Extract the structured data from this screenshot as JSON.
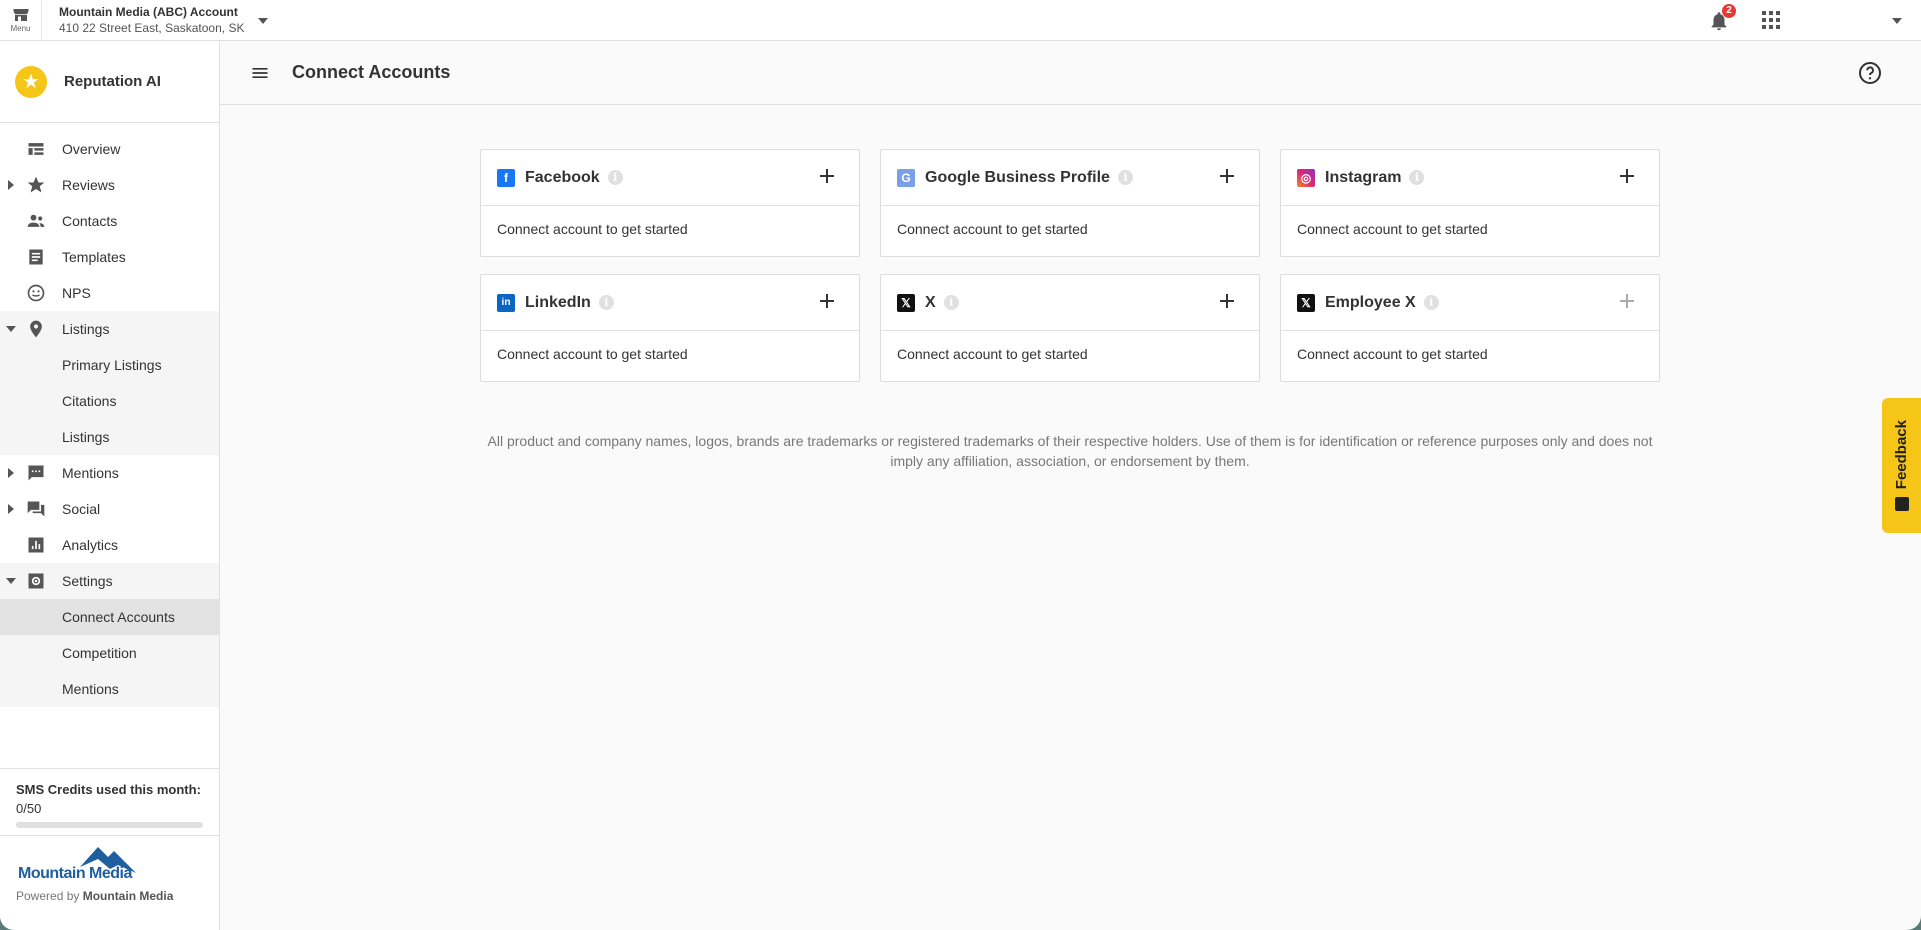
{
  "topbar": {
    "menu_label": "Menu",
    "account_name": "Mountain Media (ABC) Account",
    "account_address": "410 22 Street East, Saskatoon, SK",
    "notification_count": "2"
  },
  "sidebar": {
    "brand_name": "Reputation AI",
    "items": [
      {
        "label": "Overview",
        "icon": "overview-icon"
      },
      {
        "label": "Reviews",
        "icon": "star-icon",
        "expand": "collapsed"
      },
      {
        "label": "Contacts",
        "icon": "contacts-icon"
      },
      {
        "label": "Templates",
        "icon": "templates-icon"
      },
      {
        "label": "NPS",
        "icon": "smiley-icon"
      },
      {
        "label": "Listings",
        "icon": "location-pin-icon",
        "expand": "expanded"
      },
      {
        "label": "Primary Listings",
        "sub": true
      },
      {
        "label": "Citations",
        "sub": true
      },
      {
        "label": "Listings",
        "sub": true
      },
      {
        "label": "Mentions",
        "icon": "chat-icon",
        "expand": "collapsed"
      },
      {
        "label": "Social",
        "icon": "forum-icon",
        "expand": "collapsed"
      },
      {
        "label": "Analytics",
        "icon": "analytics-icon"
      },
      {
        "label": "Settings",
        "icon": "settings-icon",
        "expand": "expanded"
      },
      {
        "label": "Connect Accounts",
        "sub": true,
        "active": true
      },
      {
        "label": "Competition",
        "sub": true
      },
      {
        "label": "Mentions",
        "sub": true
      }
    ],
    "sms_title": "SMS Credits used this month:",
    "sms_value": "0/50",
    "sms_fraction": 0,
    "logo_text": "Mountain Media",
    "powered_prefix": "Powered by ",
    "powered_name": "Mountain Media"
  },
  "header": {
    "title": "Connect Accounts"
  },
  "cards": [
    {
      "name": "Facebook",
      "logo_color": "#1877f2",
      "logo_glyph": "f",
      "body": "Connect account to get started"
    },
    {
      "name": "Google Business Profile",
      "logo_color": "#7b9ee8",
      "logo_glyph": "G",
      "body": "Connect account to get started"
    },
    {
      "name": "Instagram",
      "logo_color": "#d62976",
      "logo_glyph": "◎",
      "body": "Connect account to get started"
    },
    {
      "name": "LinkedIn",
      "logo_color": "#0a66c2",
      "logo_glyph": "in",
      "body": "Connect account to get started"
    },
    {
      "name": "X",
      "logo_color": "#111111",
      "logo_glyph": "𝕏",
      "body": "Connect account to get started"
    },
    {
      "name": "Employee X",
      "logo_color": "#111111",
      "logo_glyph": "𝕏",
      "body": "Connect account to get started",
      "disabled": true
    }
  ],
  "disclaimer": "All product and company names, logos, brands are trademarks or registered trademarks of their respective holders. Use of them is for identification or reference purposes only and does not imply any affiliation, association, or endorsement by them.",
  "feedback_label": "Feedback"
}
